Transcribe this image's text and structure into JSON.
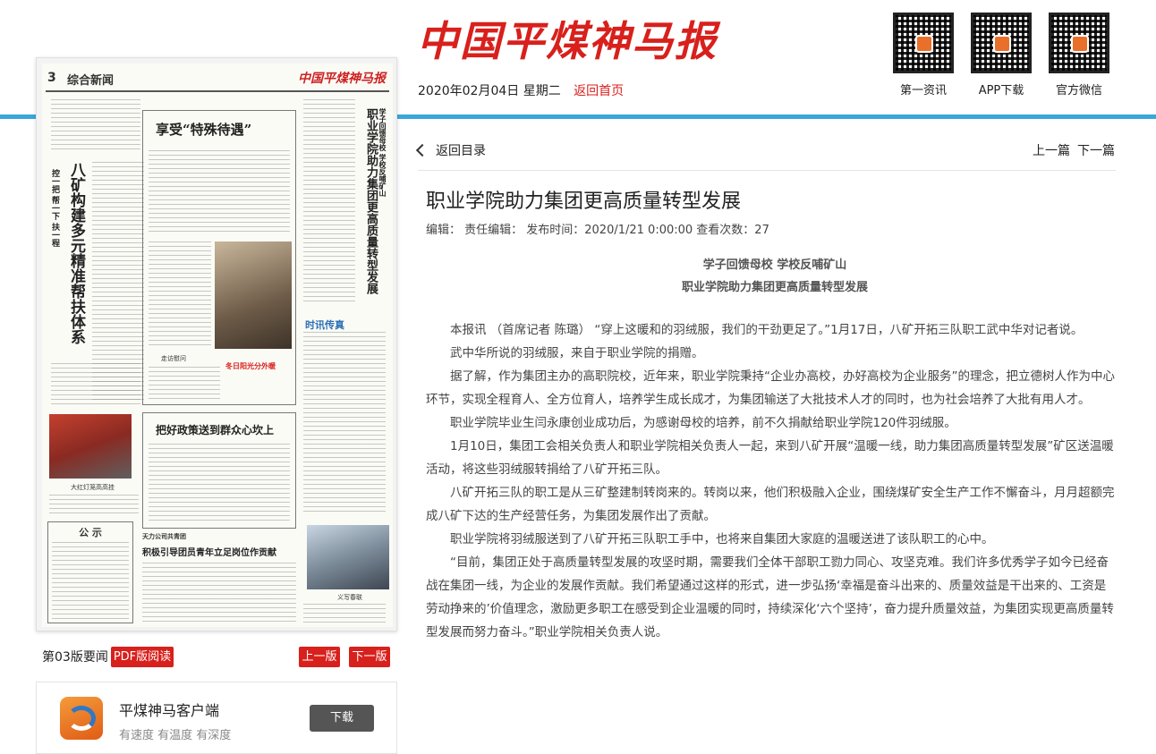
{
  "header": {
    "logo_text": "中国平煤神马报",
    "date": "2020年02月04日 星期二",
    "home_link": "返回首页",
    "qr_codes": [
      {
        "label": "第一资讯",
        "icon": "qr-code-icon"
      },
      {
        "label": "APP下载",
        "icon": "qr-code-icon"
      },
      {
        "label": "官方微信",
        "icon": "qr-code-icon"
      }
    ]
  },
  "page_preview": {
    "page_number": "3",
    "section": "综合新闻",
    "masthead": "中国平煤神马报",
    "headlines": {
      "main": "职业学院助力集团更高质量转型发展",
      "main_kicker": "学子回馈母校 学校反哺矿山",
      "special": "享受“特殊待遇”",
      "poverty": "八矿构建多元精准帮扶体系",
      "poverty_kicker": "控一把 帮一下 扶一程",
      "policy": "把好政策送到群众心坎上",
      "youth": "积极引导团员青年立足岗位作贡献",
      "youth_kicker": "天力公司共青团",
      "notice": "公 示",
      "warm": "冬日阳光分外暖",
      "flash": "时讯传真"
    },
    "captions": {
      "visit": "走访慰问",
      "lights": "大红灯笼高高挂",
      "spring": "义写春联"
    }
  },
  "page_footer": {
    "label": "第03版要闻",
    "pdf_button": "PDF版阅读",
    "prev_button": "上一版",
    "next_button": "下一版"
  },
  "app_card": {
    "name": "平煤神马客户端",
    "slogan": "有速度 有温度 有深度",
    "download_button": "下载"
  },
  "article_nav": {
    "back_to_toc": "返回目录",
    "prev": "上一篇",
    "next": "下一篇"
  },
  "article": {
    "title": "职业学院助力集团更高质量转型发展",
    "meta": "编辑：  责任编辑：  发布时间：2020/1/21 0:00:00 查看次数：27",
    "subheads": [
      "学子回馈母校 学校反哺矿山",
      "职业学院助力集团更高质量转型发展"
    ],
    "paragraphs": [
      "本报讯 （首席记者 陈璐） “穿上这暖和的羽绒服，我们的干劲更足了。”1月17日，八矿开拓三队职工武中华对记者说。",
      "武中华所说的羽绒服，来自于职业学院的捐赠。",
      "据了解，作为集团主办的高职院校，近年来，职业学院秉持“企业办高校，办好高校为企业服务”的理念，把立德树人作为中心环节，实现全程育人、全方位育人，培养学生成长成才，为集团输送了大批技术人才的同时，也为社会培养了大批有用人才。",
      "职业学院毕业生闫永康创业成功后，为感谢母校的培养，前不久捐献给职业学院120件羽绒服。",
      "1月10日，集团工会相关负责人和职业学院相关负责人一起，来到八矿开展“温暖一线，助力集团高质量转型发展”矿区送温暖活动，将这些羽绒服转捐给了八矿开拓三队。",
      "八矿开拓三队的职工是从三矿整建制转岗来的。转岗以来，他们积极融入企业，围绕煤矿安全生产工作不懈奋斗，月月超额完成八矿下达的生产经营任务，为集团发展作出了贡献。",
      "职业学院将羽绒服送到了八矿开拓三队职工手中，也将来自集团大家庭的温暖送进了该队职工的心中。",
      "“目前，集团正处于高质量转型发展的攻坚时期，需要我们全体干部职工勠力同心、攻坚克难。我们许多优秀学子如今已经奋战在集团一线，为企业的发展作贡献。我们希望通过这样的形式，进一步弘扬‘幸福是奋斗出来的、质量效益是干出来的、工资是劳动挣来的’价值理念，激励更多职工在感受到企业温暖的同时，持续深化‘六个坚持’，奋力提升质量效益，为集团实现更高质量转型发展而努力奋斗。”职业学院相关负责人说。"
    ]
  },
  "colors": {
    "brand_red": "#d8201c",
    "accent_blue": "#3aa7d8"
  }
}
